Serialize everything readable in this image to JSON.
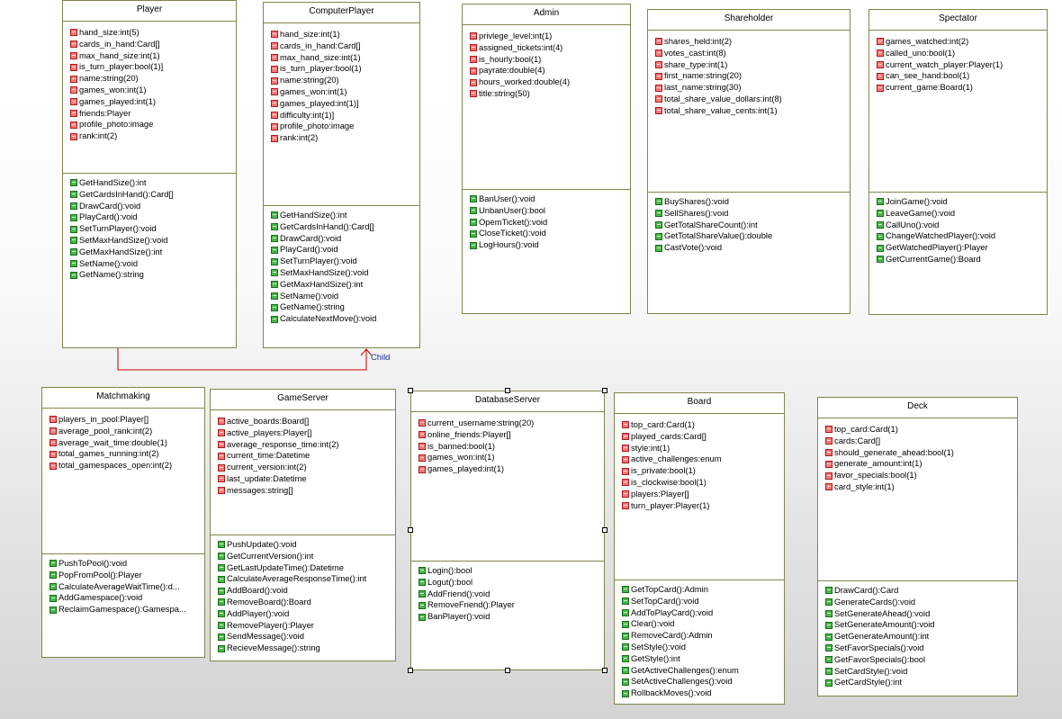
{
  "relationship": {
    "label": "Child",
    "line_color": "#cc0000"
  },
  "colors": {
    "border": "#85844a",
    "attribute_icon": "#ff7878",
    "operation_icon": "#47b847"
  },
  "classes": [
    {
      "name": "Player",
      "attributes": [
        "hand_size:int(5)",
        "cards_in_hand:Card[]",
        "max_hand_size:int(1)",
        "is_turn_player:bool(1)]",
        "name:string(20)",
        "games_won:int(1)",
        "games_played:int(1)",
        "friends:Player",
        "profile_photo:image",
        "rank:int(2)"
      ],
      "operations": [
        "GetHandSize():int",
        "GetCardsInHand():Card[]",
        "DrawCard():void",
        "PlayCard():void",
        "SetTurnPlayer():void",
        "SetMaxHandSize():void",
        "GetMaxHandSize():int",
        "SetName():void",
        "GetName():string"
      ]
    },
    {
      "name": "ComputerPlayer",
      "attributes": [
        "hand_size:int(1)",
        "cards_in_hand:Card[]",
        "max_hand_size:int(1)",
        "is_turn_player:bool(1)",
        "name:string(20)",
        "games_won:int(1)",
        "games_played:int(1)]",
        "difficulty:int(1)]",
        "profile_photo:image",
        "rank:int(2)"
      ],
      "operations": [
        "GetHandSize():int",
        "GetCardsInHand():Card[]",
        "DrawCard():void",
        "PlayCard():void",
        "SetTurnPlayer():void",
        "SetMaxHandSize():void",
        "GetMaxHandSize():int",
        "SetName():void",
        "GetName():string",
        "CalculateNextMove():void"
      ]
    },
    {
      "name": "Admin",
      "attributes": [
        "privlege_level:int(1)",
        "assigned_tickets:int(4)",
        "is_hourly:bool(1)",
        "payrate:double(4)",
        "hours_worked:double(4)",
        "title:string(50)"
      ],
      "operations": [
        "BanUser():void",
        "UnbanUser():bool",
        "OpemTicket():void",
        "CloseTicket():void",
        "LogHours():void"
      ]
    },
    {
      "name": "Shareholder",
      "attributes": [
        "shares_held:int(2)",
        "votes_cast:int(8)",
        "share_type:int(1)",
        "first_name:string(20)",
        "last_name:string(30)",
        "total_share_value_dollars:int(8)",
        "total_share_value_cents:int(1)"
      ],
      "operations": [
        "BuyShares():void",
        "SellShares():void",
        "GetTotalShareCount():int",
        "GetTotalShareValue():double",
        "CastVote():void"
      ]
    },
    {
      "name": "Spectator",
      "attributes": [
        "games_watched:int(2)",
        "called_uno:bool(1)",
        "current_watch_player:Player(1)",
        "can_see_hand:bool(1)",
        "current_game:Board(1)"
      ],
      "operations": [
        "JoinGame():void",
        "LeaveGame():void",
        "CallUno():void",
        "ChangeWatchedPlayer():void",
        "GetWatchedPlayer():Player",
        "GetCurrentGame():Board"
      ]
    },
    {
      "name": "Matchmaking",
      "attributes": [
        "players_in_pool:Player[]",
        "average_pool_rank:int(2)",
        "average_wait_time:double(1)",
        "total_games_running:int(2)",
        "total_gamespaces_open:int(2)"
      ],
      "operations": [
        "PushToPool():void",
        "PopFromPool():Player",
        "CalculateAverageWaitTime():d...",
        "AddGamespace():void",
        "ReclaimGamespace():Gamespa..."
      ]
    },
    {
      "name": "GameServer",
      "attributes": [
        "active_boards:Board[]",
        "active_players:Player[]",
        "average_response_time:int(2)",
        "current_time:Datetime",
        "current_version:int(2)",
        "last_update:Datetime",
        "messages:string[]"
      ],
      "operations": [
        "PushUpdate():void",
        "GetCurrentVersion():int",
        "GetLastUpdateTime():Datetime",
        "CalculateAverageResponseTime():int",
        "AddBoard():void",
        "RemoveBoard():Board",
        "AddPlayer():void",
        "RemovePlayer():Player",
        "SendMessage():void",
        "RecieveMessage():string"
      ]
    },
    {
      "name": "DatabaseServer",
      "attributes": [
        "current_username:string(20)",
        "online_friends:Player[]",
        "is_banned:bool(1)",
        "games_won:int(1)",
        "games_played:int(1)"
      ],
      "operations": [
        "Login():bool",
        "Logut():bool",
        "AddFriend():void",
        "RemoveFriend():Player",
        "BanPlayer():void"
      ]
    },
    {
      "name": "Board",
      "attributes": [
        "top_card:Card(1)",
        "played_cards:Card[]",
        "style:int(1)",
        "active_challenges:enum",
        "is_private:bool(1)",
        "is_clockwise:bool(1)",
        "players:Player[]",
        "turn_player:Player(1)"
      ],
      "operations": [
        "GetTopCard():Admin",
        "SetTopCard():void",
        "AddToPlayCard():void",
        "Clear():void",
        "RemoveCard():Admin",
        "SetStyle():void",
        "GetStyle():int",
        "GetActiveChallenges():enum",
        "SetActiveChallenges():void",
        "RollbackMoves():void"
      ]
    },
    {
      "name": "Deck",
      "attributes": [
        "top_card:Card(1)",
        "cards:Card[]",
        "should_generate_ahead:bool(1)",
        "generate_amount:int(1)",
        "favor_specials:bool(1)",
        "card_style:int(1)"
      ],
      "operations": [
        "DrawCard():Card",
        "GenerateCards():void",
        "SetGenerateAhead():void",
        "SetGenerateAmount():void",
        "GetGenerateAmount():int",
        "SetFavorSpecials():void",
        "GetFavorSpecials():bool",
        "SetCardStyle():void",
        "GetCardStyle():int"
      ]
    }
  ]
}
